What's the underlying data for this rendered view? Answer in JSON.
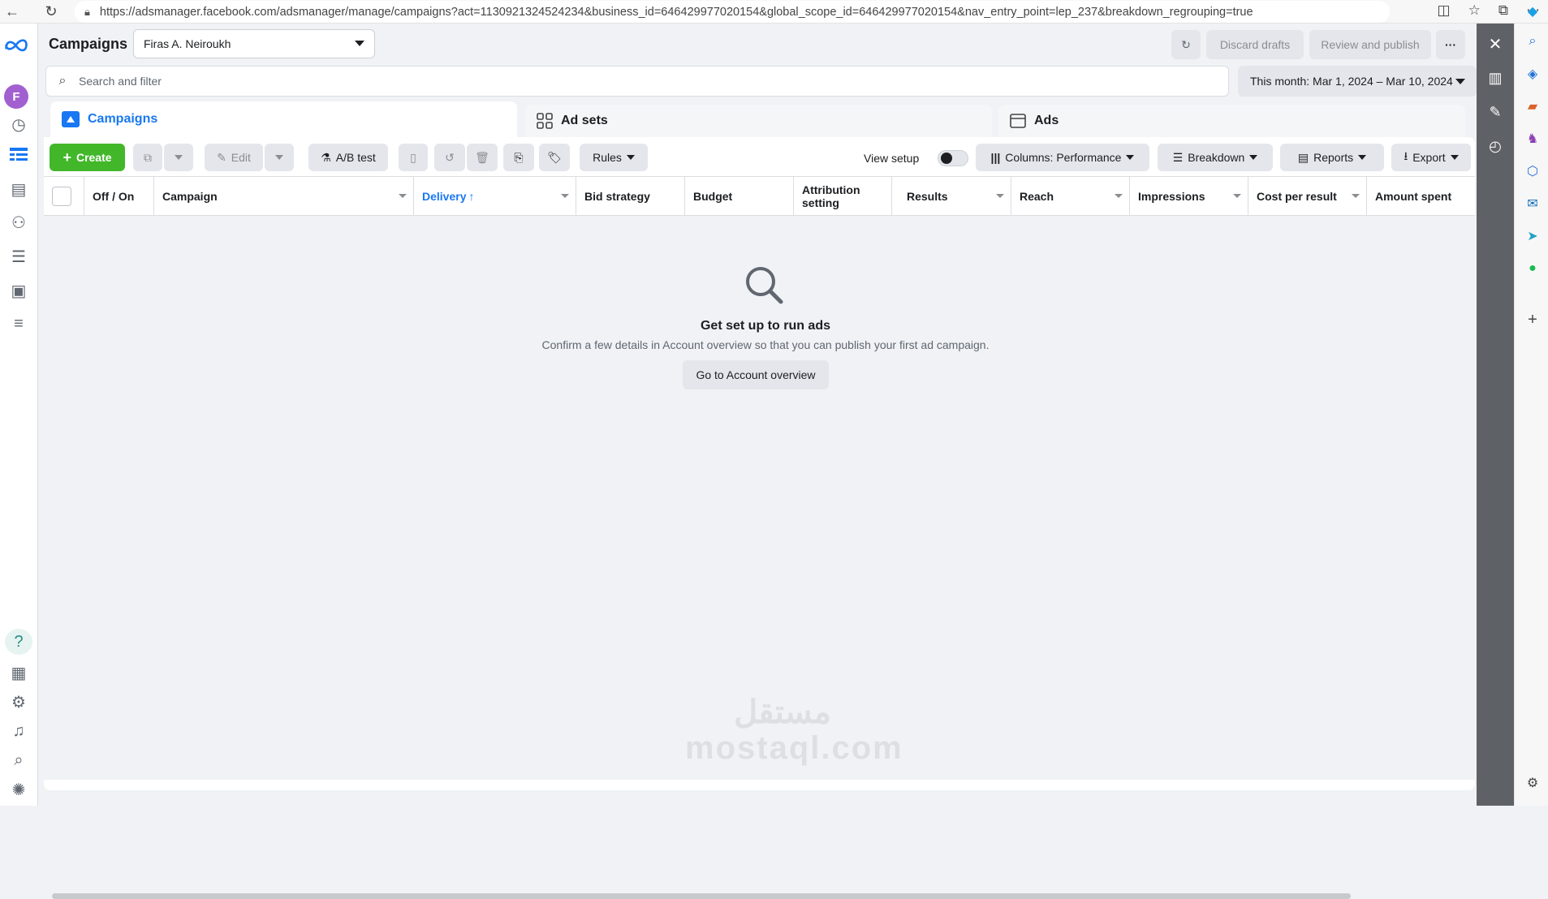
{
  "browser": {
    "url": "https://adsmanager.facebook.com/adsmanager/manage/campaigns?act=1130921324524234&business_id=646429977020154&global_scope_id=646429977020154&nav_entry_point=lep_237&breakdown_regrouping=true"
  },
  "left_nav": {
    "avatar_letter": "F",
    "help_label": "?"
  },
  "header": {
    "title": "Campaigns",
    "account": "Firas A. Neiroukh",
    "discard_label": "Discard drafts",
    "review_label": "Review and publish",
    "more_label": "···"
  },
  "search": {
    "placeholder": "Search and filter"
  },
  "date_range": "This month: Mar 1, 2024 – Mar 10, 2024",
  "tabs": [
    {
      "label": "Campaigns"
    },
    {
      "label": "Ad sets"
    },
    {
      "label": "Ads"
    }
  ],
  "toolbar": {
    "create_label": "Create",
    "edit_label": "Edit",
    "ab_test_label": "A/B test",
    "rules_label": "Rules",
    "view_setup_label": "View setup",
    "columns_label": "Columns: Performance",
    "breakdown_label": "Breakdown",
    "reports_label": "Reports",
    "export_label": "Export"
  },
  "table": {
    "columns": [
      "Off / On",
      "Campaign",
      "Delivery",
      "Bid strategy",
      "Budget",
      "Attribution setting",
      "Results",
      "Reach",
      "Impressions",
      "Cost per result",
      "Amount spent"
    ],
    "sorted_column": "Delivery",
    "sort_arrow": "↑"
  },
  "empty_state": {
    "title": "Get set up to run ads",
    "description": "Confirm a few details in Account overview so that you can publish your first ad campaign.",
    "button_label": "Go to Account overview"
  },
  "watermark": "مستقل mostaql.com",
  "colors": {
    "accent": "#1877f2",
    "create_green": "#42b72a",
    "avatar": "#a25fd0"
  }
}
